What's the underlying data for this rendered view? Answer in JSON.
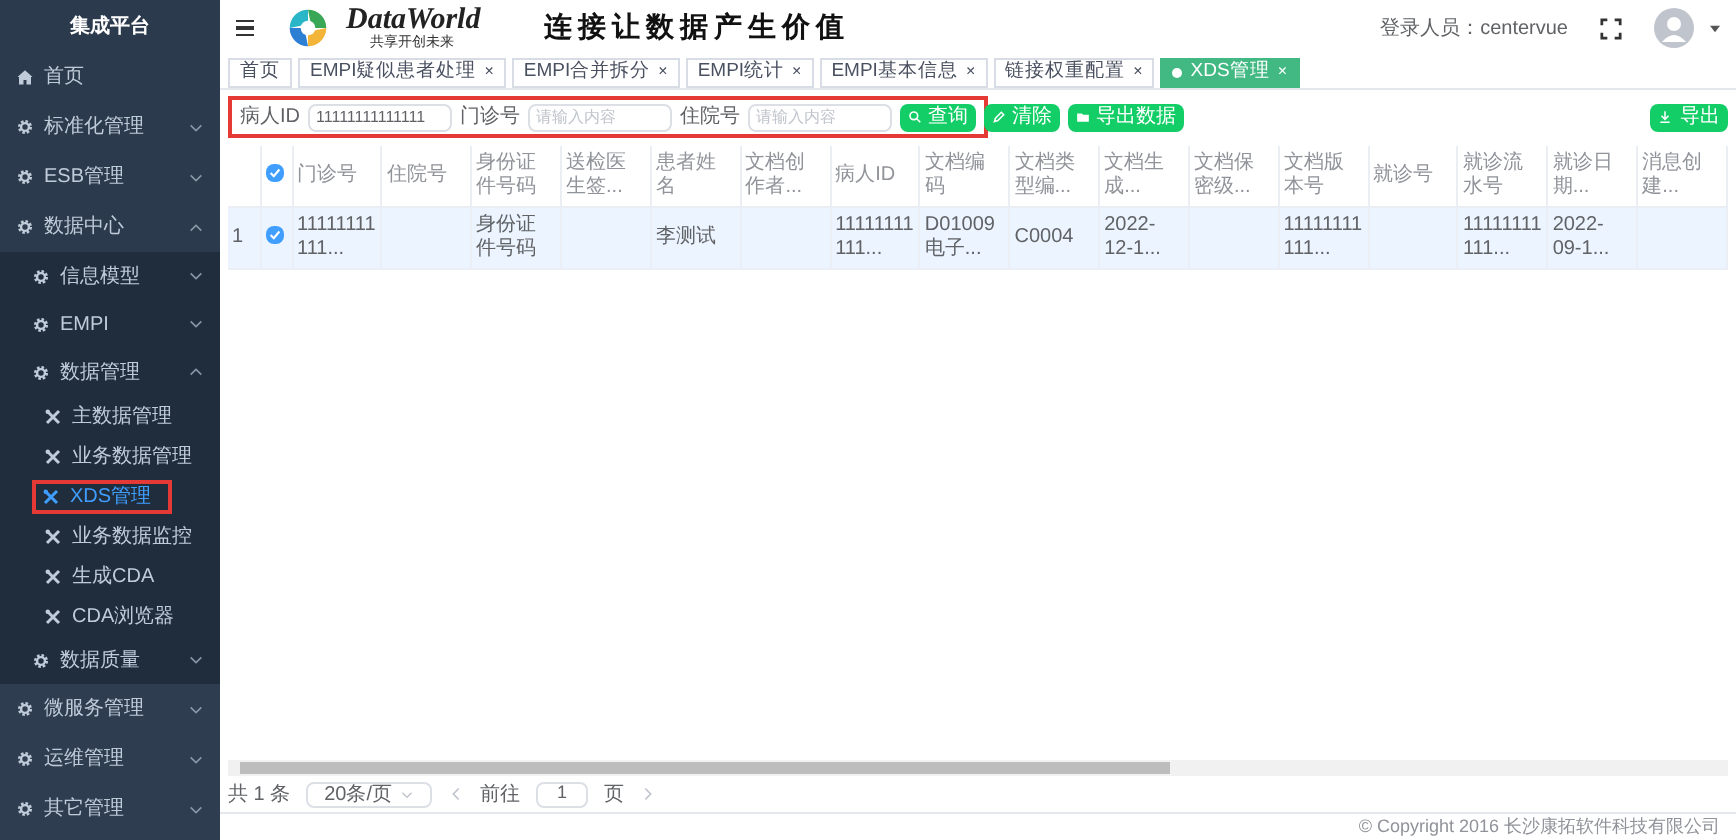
{
  "sidebar": {
    "title": "集成平台",
    "items": [
      {
        "label": "首页",
        "kind": "home",
        "selected": false
      },
      {
        "label": "标准化管理",
        "kind": "gear",
        "expanded": false,
        "selected": false
      },
      {
        "label": "ESB管理",
        "kind": "gear",
        "expanded": false,
        "selected": false
      },
      {
        "label": "数据中心",
        "kind": "gear",
        "expanded": true,
        "selected": false,
        "children": [
          {
            "label": "信息模型",
            "kind": "gear",
            "expanded": false,
            "selected": false
          },
          {
            "label": "EMPI",
            "kind": "gear",
            "expanded": false,
            "selected": false
          },
          {
            "label": "数据管理",
            "kind": "gear",
            "expanded": true,
            "selected": false,
            "children": [
              {
                "label": "主数据管理",
                "kind": "tool",
                "selected": false
              },
              {
                "label": "业务数据管理",
                "kind": "tool",
                "selected": false
              },
              {
                "label": "XDS管理",
                "kind": "tool",
                "selected": true
              },
              {
                "label": "业务数据监控",
                "kind": "tool",
                "selected": false
              },
              {
                "label": "生成CDA",
                "kind": "tool",
                "selected": false
              },
              {
                "label": "CDA浏览器",
                "kind": "tool",
                "selected": false
              }
            ]
          },
          {
            "label": "数据质量",
            "kind": "gear",
            "expanded": false,
            "selected": false
          }
        ]
      },
      {
        "label": "微服务管理",
        "kind": "gear",
        "expanded": false,
        "selected": false
      },
      {
        "label": "运维管理",
        "kind": "gear",
        "expanded": false,
        "selected": false
      },
      {
        "label": "其它管理",
        "kind": "gear",
        "expanded": false,
        "selected": false
      }
    ]
  },
  "header": {
    "logo_text": "DataWorld",
    "logo_subtitle": "共享开创未来",
    "slogan": "连接让数据产生价值",
    "user_label": "登录人员：centervue"
  },
  "tabs": [
    {
      "label": "首页",
      "selected": false
    },
    {
      "label": "EMPI疑似患者处理",
      "close": "×",
      "selected": false
    },
    {
      "label": "EMPI合并拆分",
      "close": "×",
      "selected": false
    },
    {
      "label": "EMPI统计",
      "close": "×",
      "selected": false
    },
    {
      "label": "EMPI基本信息",
      "close": "×",
      "selected": false
    },
    {
      "label": "链接权重配置",
      "close": "×",
      "selected": false
    },
    {
      "label": "XDS管理",
      "close": "×",
      "selected": true
    }
  ],
  "filters": [
    {
      "label": "病人ID",
      "value": "11111111111111"
    },
    {
      "label": "门诊号",
      "placeholder": "请输入内容"
    },
    {
      "label": "住院号",
      "placeholder": "请输入内容"
    }
  ],
  "actions": [
    {
      "label": "查询",
      "kind": "search"
    },
    {
      "label": "清除",
      "kind": "clear"
    },
    {
      "label": "导出数据",
      "kind": "folder"
    }
  ],
  "export_button": "导出",
  "table": {
    "all_selected": true,
    "columns": [
      "门诊号",
      "住院号",
      "身份证件号码",
      "送检医生签...",
      "患者姓名",
      "文档创作者...",
      "病人ID",
      "文档编码",
      "文档类型编...",
      "文档生成...",
      "文档保密级...",
      "文档版本号",
      "就诊号",
      "就诊流水号",
      "就诊日期...",
      "消息创建..."
    ],
    "rows": [
      {
        "index": "1",
        "selected": true,
        "cells": [
          "11111111111...",
          "",
          "身份证件号码",
          "",
          "李测试",
          "",
          "11111111111...",
          "D01009电子...",
          "C0004",
          "2022-12-1...",
          "",
          "11111111111...",
          "",
          "11111111111...",
          "2022-09-1...",
          ""
        ]
      }
    ]
  },
  "pagination": {
    "total": "共 1 条",
    "page_size": "20条/页",
    "goto_label": "前往",
    "page": "1",
    "page_suffix": "页"
  },
  "footer": "© Copyright 2016 长沙康拓软件科技有限公司"
}
